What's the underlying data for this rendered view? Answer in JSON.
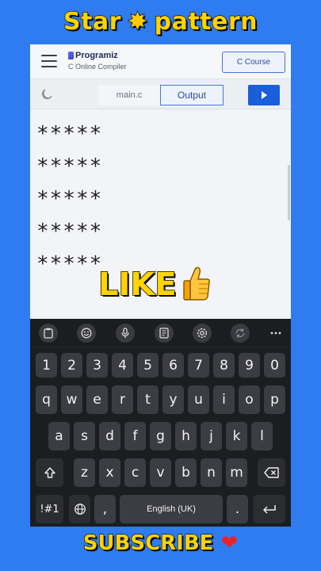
{
  "overlay": {
    "title_left": "Star",
    "title_icon": "star-glow-icon",
    "title_right": "pattern",
    "like": "LIKE",
    "subscribe": "SUBSCRIBE",
    "subscribe_icon": "heart-icon"
  },
  "header": {
    "logo": "Programiz",
    "subtitle": "C Online Compiler",
    "course_button": "C Course"
  },
  "tabs": {
    "file": "main.c",
    "output": "Output",
    "active": "Output"
  },
  "output_lines": [
    "*****",
    "*****",
    "*****",
    "*****",
    "*****"
  ],
  "keyboard": {
    "toolbar_icons": [
      "clipboard-icon",
      "emoji-icon",
      "mic-icon",
      "translate-icon",
      "settings-icon",
      "refresh-icon",
      "more-icon"
    ],
    "row_numbers": [
      "1",
      "2",
      "3",
      "4",
      "5",
      "6",
      "7",
      "8",
      "9",
      "0"
    ],
    "row_1": [
      "q",
      "w",
      "e",
      "r",
      "t",
      "y",
      "u",
      "i",
      "o",
      "p"
    ],
    "row_2": [
      "a",
      "s",
      "d",
      "f",
      "g",
      "h",
      "j",
      "k",
      "l"
    ],
    "row_3": [
      "z",
      "x",
      "c",
      "v",
      "b",
      "n",
      "m"
    ],
    "symbols": "!#1",
    "comma": ",",
    "space": "English (UK)",
    "period": "."
  },
  "colors": {
    "accent": "#1a5fd9",
    "overlay_text": "#ffd400",
    "background": "#2f7bf0"
  }
}
